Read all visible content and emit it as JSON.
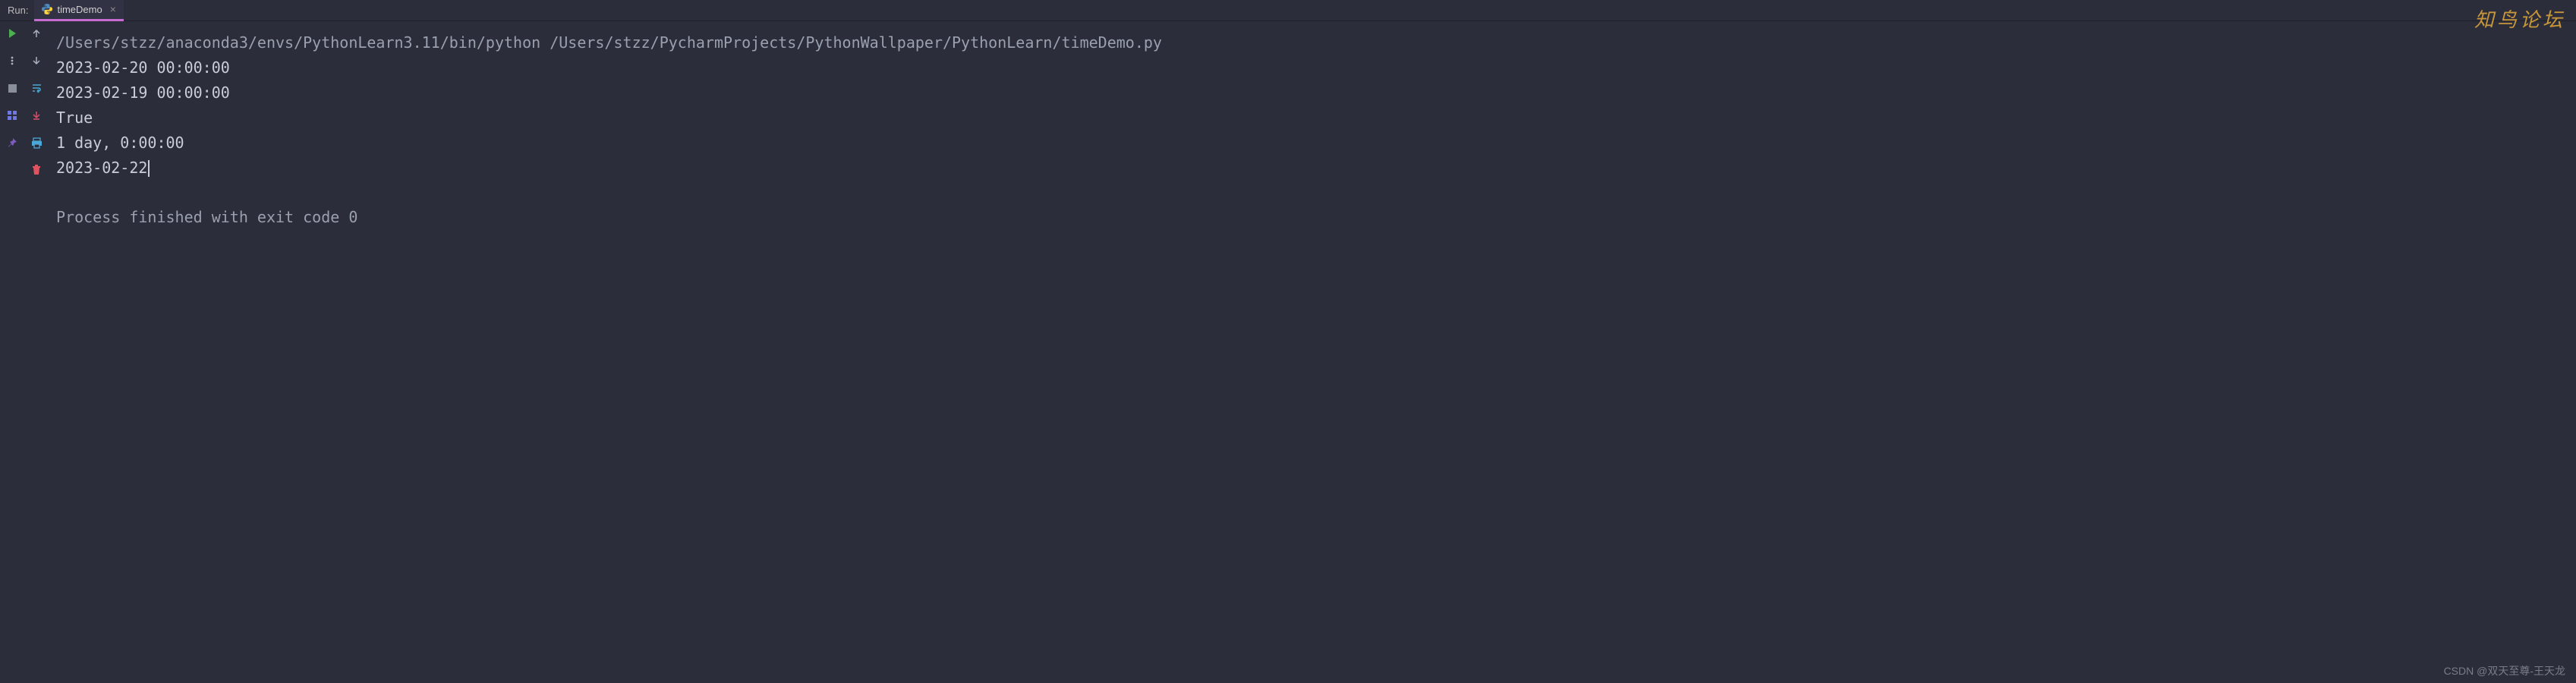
{
  "header": {
    "run_label": "Run:",
    "tab": {
      "name": "timeDemo",
      "close_glyph": "×"
    }
  },
  "gutter": {
    "col1": [
      {
        "name": "run-icon",
        "color": "#4caf50"
      },
      {
        "name": "more-icon",
        "color": "#aab1c0"
      },
      {
        "name": "stop-icon",
        "color": "#8a8f9c"
      },
      {
        "name": "layout-icon",
        "color": "#6f78e0"
      },
      {
        "name": "pin-icon",
        "color": "#7d5bbf"
      }
    ],
    "col2": [
      {
        "name": "step-up-icon",
        "color": "#aab1c0"
      },
      {
        "name": "step-down-icon",
        "color": "#aab1c0"
      },
      {
        "name": "wrap-icon",
        "color": "#4aa8d8"
      },
      {
        "name": "scroll-end-icon",
        "color": "#d94f6a"
      },
      {
        "name": "print-icon",
        "color": "#4aa8d8"
      },
      {
        "name": "delete-icon",
        "color": "#e05260"
      }
    ]
  },
  "console": {
    "command": "/Users/stzz/anaconda3/envs/PythonLearn3.11/bin/python /Users/stzz/PycharmProjects/PythonWallpaper/PythonLearn/timeDemo.py",
    "lines": [
      "2023-02-20 00:00:00",
      "2023-02-19 00:00:00",
      "True",
      "1 day, 0:00:00",
      "2023-02-22"
    ],
    "exit_message": "Process finished with exit code 0"
  },
  "watermarks": {
    "top_right": "知鸟论坛",
    "bottom_right": "CSDN @双天至尊-王天龙"
  }
}
